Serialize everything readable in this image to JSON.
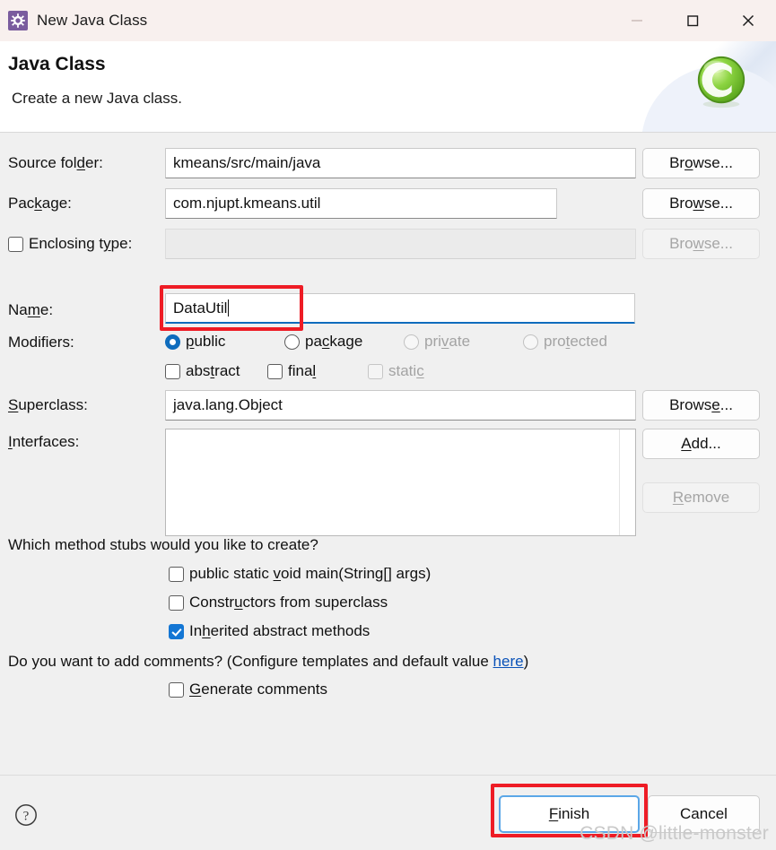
{
  "window": {
    "title": "New Java Class",
    "icon": "java-class-wizard-icon",
    "controls": {
      "minimize": "minimize-icon",
      "maximize": "maximize-icon",
      "close": "close-icon"
    }
  },
  "header": {
    "title": "Java Class",
    "subtitle": "Create a new Java class.",
    "logo": "eclipse-class-logo"
  },
  "form": {
    "source_folder": {
      "label_before": "Source fol",
      "label_mnemonic": "d",
      "label_after": "er:",
      "value": "kmeans/src/main/java",
      "button": {
        "before": "Br",
        "mnemonic": "o",
        "after": "wse..."
      }
    },
    "package": {
      "label_before": "Pac",
      "label_mnemonic": "k",
      "label_after": "age:",
      "value": "com.njupt.kmeans.util",
      "button": {
        "before": "Bro",
        "mnemonic": "w",
        "after": "se..."
      }
    },
    "enclosing_type": {
      "label_before": "Enclosing t",
      "label_mnemonic": "y",
      "label_after": "pe:",
      "value": "",
      "checked": false,
      "enabled": false,
      "button": {
        "before": "Bro",
        "mnemonic": "w",
        "after": "se..."
      }
    },
    "name": {
      "label_before": "Na",
      "label_mnemonic": "m",
      "label_after": "e:",
      "value": "DataUtil"
    },
    "modifiers": {
      "label": "Modifiers:",
      "radios": [
        {
          "before": "",
          "mnemonic": "p",
          "after": "ublic",
          "checked": true,
          "enabled": true
        },
        {
          "before": "pa",
          "mnemonic": "c",
          "after": "kage",
          "checked": false,
          "enabled": true
        },
        {
          "before": "pri",
          "mnemonic": "v",
          "after": "ate",
          "checked": false,
          "enabled": false
        },
        {
          "before": "pro",
          "mnemonic": "t",
          "after": "ected",
          "checked": false,
          "enabled": false
        }
      ],
      "checkboxes": [
        {
          "before": "abs",
          "mnemonic": "t",
          "after": "ract",
          "checked": false,
          "enabled": true
        },
        {
          "before": "fina",
          "mnemonic": "l",
          "after": "",
          "checked": false,
          "enabled": true
        },
        {
          "before": "stati",
          "mnemonic": "c",
          "after": "",
          "checked": false,
          "enabled": false
        }
      ]
    },
    "superclass": {
      "label_before": "",
      "label_mnemonic": "S",
      "label_after": "uperclass:",
      "value": "java.lang.Object",
      "button": {
        "before": "Brows",
        "mnemonic": "e",
        "after": "..."
      }
    },
    "interfaces": {
      "label_before": "",
      "label_mnemonic": "I",
      "label_after": "nterfaces:",
      "items": [],
      "add_button": {
        "before": "",
        "mnemonic": "A",
        "after": "dd..."
      },
      "remove_button": {
        "before": "",
        "mnemonic": "R",
        "after": "emove",
        "enabled": false
      }
    }
  },
  "stubs": {
    "question": "Which method stubs would you like to create?",
    "options": [
      {
        "before": "public static ",
        "mnemonic": "v",
        "after": "oid main(String[] args)",
        "checked": false
      },
      {
        "before": "Constr",
        "mnemonic": "u",
        "after": "ctors from superclass",
        "checked": false
      },
      {
        "before": "In",
        "mnemonic": "h",
        "after": "erited abstract methods",
        "checked": true
      }
    ]
  },
  "comments": {
    "question_before": "Do you want to add comments? (Configure templates and default value ",
    "link": "here",
    "question_after": ")",
    "option": {
      "before": "",
      "mnemonic": "G",
      "after": "enerate comments",
      "checked": false
    }
  },
  "footer": {
    "help": "help-icon",
    "finish": {
      "before": "",
      "mnemonic": "F",
      "after": "inish"
    },
    "cancel": "Cancel"
  },
  "watermark": "CSDN @little-monster"
}
